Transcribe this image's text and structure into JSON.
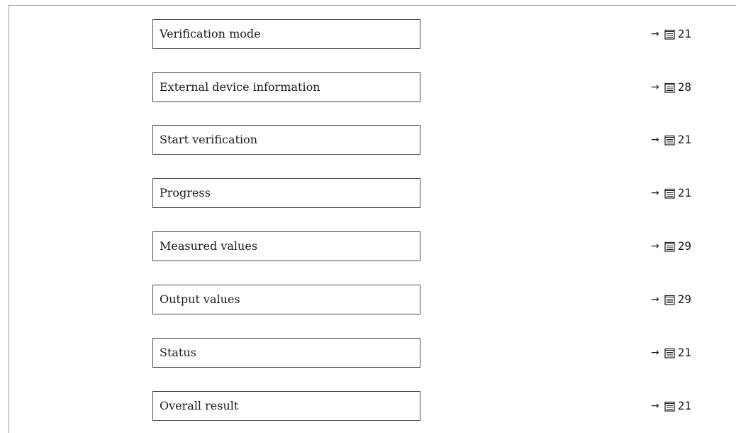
{
  "items": [
    {
      "label": "Verification mode",
      "arrow": "→",
      "page": "21"
    },
    {
      "label": "External device information",
      "arrow": "→",
      "page": "28"
    },
    {
      "label": "Start verification",
      "arrow": "→",
      "page": "21"
    },
    {
      "label": "Progress",
      "arrow": "→",
      "page": "21"
    },
    {
      "label": "Measured values",
      "arrow": "→",
      "page": "29"
    },
    {
      "label": "Output values",
      "arrow": "→",
      "page": "29"
    },
    {
      "label": "Status",
      "arrow": "→",
      "page": "21"
    },
    {
      "label": "Overall result",
      "arrow": "→",
      "page": "21"
    }
  ],
  "icons": {
    "page_reference": "page-book-icon"
  },
  "colors": {
    "border": "#4a4a4a",
    "frame": "#9a9a9a",
    "text": "#1a1a1a"
  }
}
